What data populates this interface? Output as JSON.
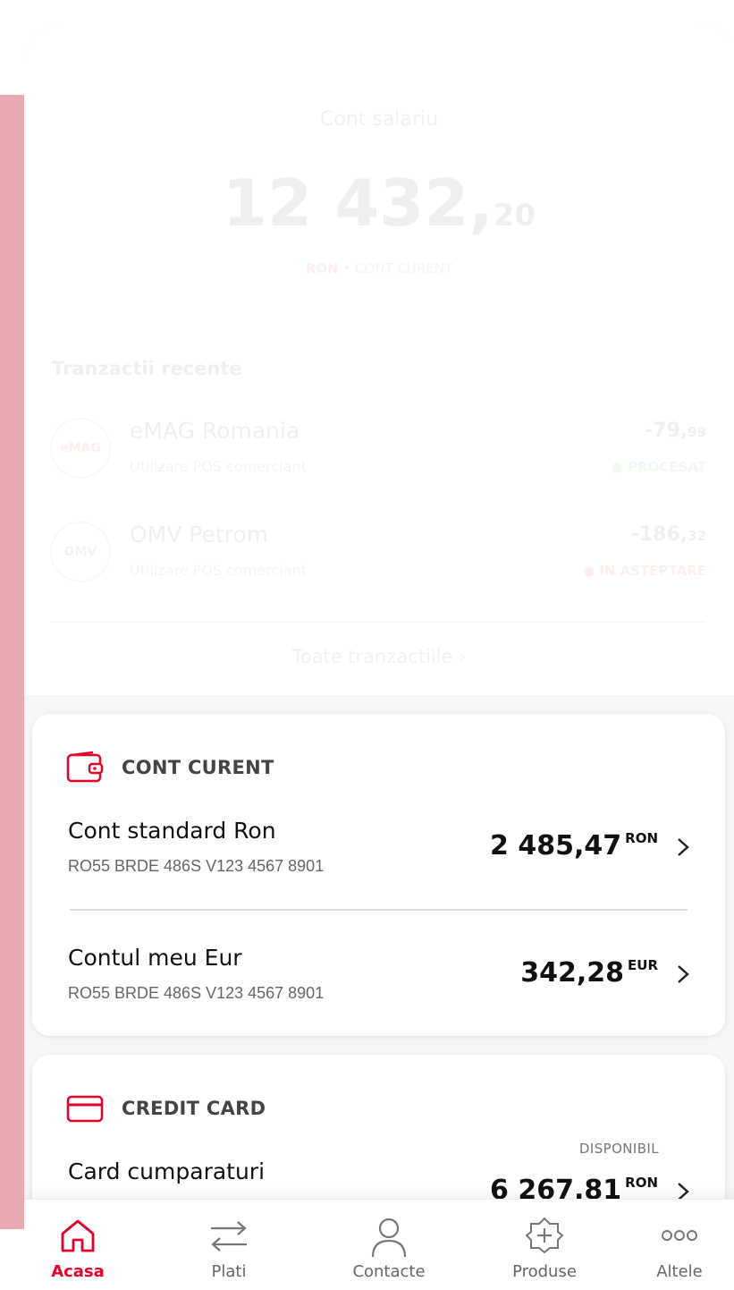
{
  "summary": {
    "account_title": "Cont salariu",
    "balance_int": "12 432,",
    "balance_dec": "20",
    "currency": "RON",
    "separator": " • ",
    "account_type": "CONT CURENT"
  },
  "recent": {
    "heading": "Tranzactii recente",
    "items": [
      {
        "logo": "eMAG",
        "name": "eMAG Romania",
        "desc": "Utilizare POS comerciant",
        "amount_int": "-79,",
        "amount_dec": "99",
        "status": "● PROCESAT"
      },
      {
        "logo": "OMV",
        "name": "OMV Petrom",
        "desc": "Utilizare POS comerciant",
        "amount_int": "-186,",
        "amount_dec": "32",
        "status": "● IN ASTEPTARE"
      }
    ],
    "all_link": "Toate tranzactiile"
  },
  "current_account_card": {
    "label": "CONT CURENT",
    "icon": "wallet-icon",
    "accounts": [
      {
        "name": "Cont standard Ron",
        "iban": "RO55 BRDE 486S V123 4567 8901",
        "amount": "2 485,47",
        "currency": "RON"
      },
      {
        "name": "Contul meu Eur",
        "iban": "RO55 BRDE 486S V123 4567 8901",
        "amount": "342,28",
        "currency": "EUR"
      }
    ]
  },
  "credit_card": {
    "label": "CREDIT CARD",
    "icon": "credit-card-icon",
    "name": "Card cumparaturi",
    "available_label": "DISPONIBIL",
    "amount": "6 267.81",
    "currency": "RON"
  },
  "nav": {
    "items": [
      {
        "label": "Acasa",
        "icon": "home-icon",
        "active": true
      },
      {
        "label": "Plati",
        "icon": "transfer-icon",
        "active": false
      },
      {
        "label": "Contacte",
        "icon": "person-icon",
        "active": false
      },
      {
        "label": "Produse",
        "icon": "products-icon",
        "active": false
      },
      {
        "label": "Altele",
        "icon": "more-icon",
        "active": false
      }
    ]
  },
  "colors": {
    "accent": "#e60028",
    "side_accent": "#e9aab1",
    "processed": "#2a9d2a"
  }
}
